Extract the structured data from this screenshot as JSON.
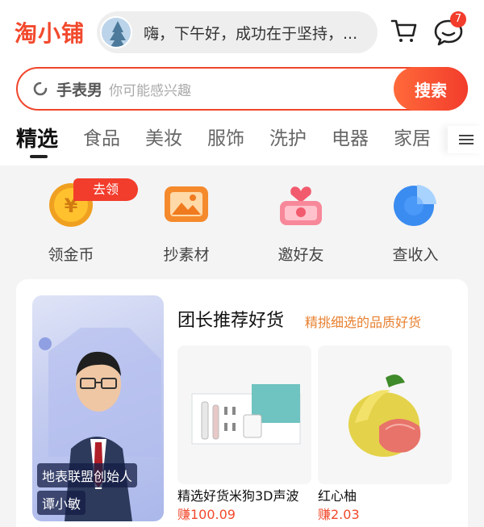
{
  "header": {
    "logo": "淘小铺",
    "greeting": "嗨，下午好，成功在于坚持，...",
    "message_badge": "7"
  },
  "search": {
    "keyword": "手表男",
    "placeholder": "你可能感兴趣",
    "button_label": "搜索"
  },
  "tabs": [
    {
      "label": "精选",
      "active": true
    },
    {
      "label": "食品"
    },
    {
      "label": "美妆"
    },
    {
      "label": "服饰"
    },
    {
      "label": "洗护"
    },
    {
      "label": "电器"
    },
    {
      "label": "家居"
    }
  ],
  "quick_actions": [
    {
      "label": "领金币",
      "icon": "gold-coin-icon"
    },
    {
      "label": "抄素材",
      "icon": "image-icon"
    },
    {
      "label": "邀好友",
      "icon": "heart-gift-icon"
    },
    {
      "label": "查收入",
      "icon": "pie-chart-icon"
    }
  ],
  "quick_badge": "去领",
  "recommend": {
    "title": "团长推荐好货",
    "subtitle": "精挑细选的品质好货",
    "leader_title": "地表联盟创始人",
    "leader_name": "谭小敏",
    "products": [
      {
        "name": "精选好货米狗3D声波",
        "price": "赚100.09"
      },
      {
        "name": "红心柚",
        "price": "赚2.03"
      }
    ]
  },
  "colors": {
    "accent": "#f2492d",
    "highlight": "#e88030"
  }
}
